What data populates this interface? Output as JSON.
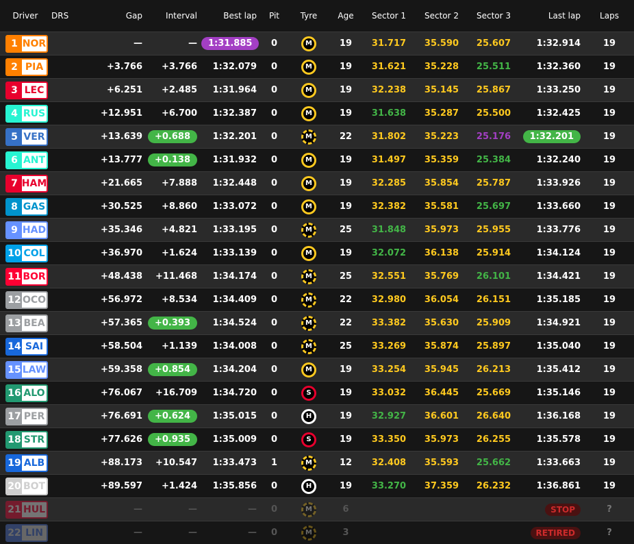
{
  "header": {
    "driver": "Driver",
    "drs": "DRS",
    "gap": "Gap",
    "interval": "Interval",
    "best": "Best lap",
    "pit": "Pit",
    "tyre": "Tyre",
    "age": "Age",
    "s1": "Sector 1",
    "s2": "Sector 2",
    "s3": "Sector 3",
    "last": "Last lap",
    "laps": "Laps"
  },
  "colors": {
    "yellow": "#ffc91f",
    "green": "#43b547",
    "purple": "#a33fc4",
    "white": "#ffffff",
    "grey": "#777777"
  },
  "rows": [
    {
      "pos": "1",
      "code": "NOR",
      "team": "#ff8000",
      "gap": "—",
      "interval": "—",
      "best": "1:31.885",
      "best_hl": "purple",
      "pit": "0",
      "tyre": "M",
      "used": false,
      "age": "19",
      "s1": "31.717",
      "s1c": "yellow",
      "s2": "35.590",
      "s2c": "yellow",
      "s3": "25.607",
      "s3c": "yellow",
      "last": "1:32.914",
      "laps": "19"
    },
    {
      "pos": "2",
      "code": "PIA",
      "team": "#ff8000",
      "gap": "+3.766",
      "interval": "+3.766",
      "best": "1:32.079",
      "pit": "0",
      "tyre": "M",
      "used": false,
      "age": "19",
      "s1": "31.621",
      "s1c": "yellow",
      "s2": "35.228",
      "s2c": "yellow",
      "s3": "25.511",
      "s3c": "green",
      "last": "1:32.360",
      "laps": "19"
    },
    {
      "pos": "3",
      "code": "LEC",
      "team": "#e8002d",
      "gap": "+6.251",
      "interval": "+2.485",
      "best": "1:31.964",
      "pit": "0",
      "tyre": "M",
      "used": false,
      "age": "19",
      "s1": "32.238",
      "s1c": "yellow",
      "s2": "35.145",
      "s2c": "yellow",
      "s3": "25.867",
      "s3c": "yellow",
      "last": "1:33.250",
      "laps": "19"
    },
    {
      "pos": "4",
      "code": "RUS",
      "team": "#27f4d2",
      "gap": "+12.951",
      "interval": "+6.700",
      "best": "1:32.387",
      "pit": "0",
      "tyre": "M",
      "used": false,
      "age": "19",
      "s1": "31.638",
      "s1c": "green",
      "s2": "35.287",
      "s2c": "yellow",
      "s3": "25.500",
      "s3c": "yellow",
      "last": "1:32.425",
      "laps": "19"
    },
    {
      "pos": "5",
      "code": "VER",
      "team": "#3671c6",
      "gap": "+13.639",
      "interval": "+0.688",
      "int_hl": "green",
      "best": "1:32.201",
      "pit": "0",
      "tyre": "M",
      "used": true,
      "age": "22",
      "s1": "31.802",
      "s1c": "yellow",
      "s2": "35.223",
      "s2c": "yellow",
      "s3": "25.176",
      "s3c": "purple",
      "last": "1:32.201",
      "last_hl": "green",
      "laps": "19"
    },
    {
      "pos": "6",
      "code": "ANT",
      "team": "#27f4d2",
      "gap": "+13.777",
      "interval": "+0.138",
      "int_hl": "green",
      "best": "1:31.932",
      "pit": "0",
      "tyre": "M",
      "used": false,
      "age": "19",
      "s1": "31.497",
      "s1c": "yellow",
      "s2": "35.359",
      "s2c": "yellow",
      "s3": "25.384",
      "s3c": "green",
      "last": "1:32.240",
      "laps": "19"
    },
    {
      "pos": "7",
      "code": "HAM",
      "team": "#e8002d",
      "gap": "+21.665",
      "interval": "+7.888",
      "best": "1:32.448",
      "pit": "0",
      "tyre": "M",
      "used": false,
      "age": "19",
      "s1": "32.285",
      "s1c": "yellow",
      "s2": "35.854",
      "s2c": "yellow",
      "s3": "25.787",
      "s3c": "yellow",
      "last": "1:33.926",
      "laps": "19"
    },
    {
      "pos": "8",
      "code": "GAS",
      "team": "#0093cc",
      "gap": "+30.525",
      "interval": "+8.860",
      "best": "1:33.072",
      "pit": "0",
      "tyre": "M",
      "used": false,
      "age": "19",
      "s1": "32.382",
      "s1c": "yellow",
      "s2": "35.581",
      "s2c": "yellow",
      "s3": "25.697",
      "s3c": "green",
      "last": "1:33.660",
      "laps": "19"
    },
    {
      "pos": "9",
      "code": "HAD",
      "team": "#6692ff",
      "gap": "+35.346",
      "interval": "+4.821",
      "best": "1:33.195",
      "pit": "0",
      "tyre": "M",
      "used": true,
      "age": "25",
      "s1": "31.848",
      "s1c": "green",
      "s2": "35.973",
      "s2c": "yellow",
      "s3": "25.955",
      "s3c": "yellow",
      "last": "1:33.776",
      "laps": "19"
    },
    {
      "pos": "10",
      "code": "COL",
      "team": "#00a1e8",
      "gap": "+36.970",
      "interval": "+1.624",
      "best": "1:33.139",
      "pit": "0",
      "tyre": "M",
      "used": false,
      "age": "19",
      "s1": "32.072",
      "s1c": "green",
      "s2": "36.138",
      "s2c": "yellow",
      "s3": "25.914",
      "s3c": "yellow",
      "last": "1:34.124",
      "laps": "19"
    },
    {
      "pos": "11",
      "code": "BOR",
      "team": "#ff0033",
      "gap": "+48.438",
      "interval": "+11.468",
      "best": "1:34.174",
      "pit": "0",
      "tyre": "M",
      "used": true,
      "age": "25",
      "s1": "32.551",
      "s1c": "yellow",
      "s2": "35.769",
      "s2c": "yellow",
      "s3": "26.101",
      "s3c": "green",
      "last": "1:34.421",
      "laps": "19"
    },
    {
      "pos": "12",
      "code": "OCO",
      "team": "#9c9fa2",
      "gap": "+56.972",
      "interval": "+8.534",
      "best": "1:34.409",
      "pit": "0",
      "tyre": "M",
      "used": true,
      "age": "22",
      "s1": "32.980",
      "s1c": "yellow",
      "s2": "36.054",
      "s2c": "yellow",
      "s3": "26.151",
      "s3c": "yellow",
      "last": "1:35.185",
      "laps": "19"
    },
    {
      "pos": "13",
      "code": "BEA",
      "team": "#9c9fa2",
      "gap": "+57.365",
      "interval": "+0.393",
      "int_hl": "green",
      "best": "1:34.524",
      "pit": "0",
      "tyre": "M",
      "used": true,
      "age": "22",
      "s1": "33.382",
      "s1c": "yellow",
      "s2": "35.630",
      "s2c": "yellow",
      "s3": "25.909",
      "s3c": "yellow",
      "last": "1:34.921",
      "laps": "19"
    },
    {
      "pos": "14",
      "code": "SAI",
      "team": "#1868db",
      "gap": "+58.504",
      "interval": "+1.139",
      "best": "1:34.008",
      "pit": "0",
      "tyre": "M",
      "used": true,
      "age": "25",
      "s1": "33.269",
      "s1c": "yellow",
      "s2": "35.874",
      "s2c": "yellow",
      "s3": "25.897",
      "s3c": "yellow",
      "last": "1:35.040",
      "laps": "19"
    },
    {
      "pos": "15",
      "code": "LAW",
      "team": "#6692ff",
      "gap": "+59.358",
      "interval": "+0.854",
      "int_hl": "green",
      "best": "1:34.204",
      "pit": "0",
      "tyre": "M",
      "used": false,
      "age": "19",
      "s1": "33.254",
      "s1c": "yellow",
      "s2": "35.945",
      "s2c": "yellow",
      "s3": "26.213",
      "s3c": "yellow",
      "last": "1:35.412",
      "laps": "19"
    },
    {
      "pos": "16",
      "code": "ALO",
      "team": "#229971",
      "gap": "+76.067",
      "interval": "+16.709",
      "best": "1:34.720",
      "pit": "0",
      "tyre": "S",
      "used": false,
      "age": "19",
      "s1": "33.032",
      "s1c": "yellow",
      "s2": "36.445",
      "s2c": "yellow",
      "s3": "25.669",
      "s3c": "yellow",
      "last": "1:35.146",
      "laps": "19"
    },
    {
      "pos": "17",
      "code": "PER",
      "team": "#9c9fa2",
      "gap": "+76.691",
      "interval": "+0.624",
      "int_hl": "green",
      "best": "1:35.015",
      "pit": "0",
      "tyre": "H",
      "used": false,
      "age": "19",
      "s1": "32.927",
      "s1c": "green",
      "s2": "36.601",
      "s2c": "yellow",
      "s3": "26.640",
      "s3c": "yellow",
      "last": "1:36.168",
      "laps": "19"
    },
    {
      "pos": "18",
      "code": "STR",
      "team": "#229971",
      "gap": "+77.626",
      "interval": "+0.935",
      "int_hl": "green",
      "best": "1:35.009",
      "pit": "0",
      "tyre": "S",
      "used": false,
      "age": "19",
      "s1": "33.350",
      "s1c": "yellow",
      "s2": "35.973",
      "s2c": "yellow",
      "s3": "26.255",
      "s3c": "yellow",
      "last": "1:35.578",
      "laps": "19"
    },
    {
      "pos": "19",
      "code": "ALB",
      "team": "#1868db",
      "gap": "+88.173",
      "interval": "+10.547",
      "best": "1:33.473",
      "pit": "1",
      "tyre": "M",
      "used": true,
      "age": "12",
      "s1": "32.408",
      "s1c": "yellow",
      "s2": "35.593",
      "s2c": "yellow",
      "s3": "25.662",
      "s3c": "green",
      "last": "1:33.663",
      "laps": "19"
    },
    {
      "pos": "20",
      "code": "BOT",
      "team": "#cfcfcf",
      "gap": "+89.597",
      "interval": "+1.424",
      "best": "1:35.856",
      "pit": "0",
      "tyre": "H",
      "used": false,
      "age": "19",
      "s1": "33.270",
      "s1c": "green",
      "s2": "37.359",
      "s2c": "yellow",
      "s3": "26.232",
      "s3c": "yellow",
      "last": "1:36.861",
      "laps": "19"
    },
    {
      "pos": "21",
      "code": "HUL",
      "team": "#ff0033",
      "gap": "—",
      "interval": "—",
      "best": "—",
      "pit": "0",
      "tyre": "M",
      "used": true,
      "age": "6",
      "status": "STOP",
      "laps": "?",
      "out": true
    },
    {
      "pos": "22",
      "code": "LIN",
      "team": "#6692ff",
      "gap": "—",
      "interval": "—",
      "best": "—",
      "pit": "0",
      "tyre": "M",
      "used": true,
      "age": "3",
      "status": "RETIRED",
      "laps": "?",
      "out": true
    }
  ]
}
